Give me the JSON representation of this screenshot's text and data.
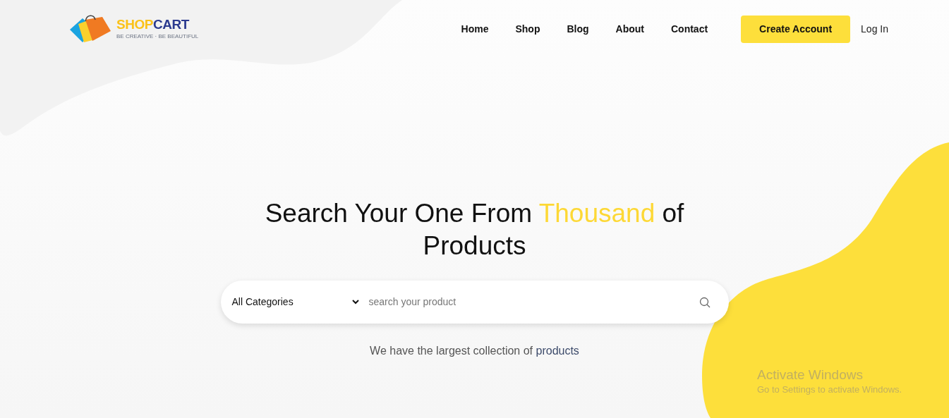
{
  "logo": {
    "brand_parts": [
      {
        "text": "SHOP",
        "highlight": true
      },
      {
        "text": "CART",
        "highlight": false
      }
    ],
    "tagline": "BE CREATIVE · BE BEAUTIFUL"
  },
  "nav": {
    "links": [
      "Home",
      "Shop",
      "Blog",
      "About",
      "Contact"
    ],
    "create_account": "Create Account",
    "login": "Log In"
  },
  "hero": {
    "headline_parts": [
      {
        "text": "Search Your One From ",
        "highlight": false
      },
      {
        "text": "Thousand",
        "highlight": true
      },
      {
        "text": " of Products",
        "highlight": false
      }
    ],
    "search": {
      "category": "All Categories",
      "placeholder": "search your product"
    },
    "subtitle_parts": [
      {
        "text": "We have the largest collection of ",
        "highlight": false
      },
      {
        "text": "products",
        "highlight": true
      }
    ]
  },
  "system_notice": {
    "title": "Activate Windows",
    "message": "Go to Settings to activate Windows."
  }
}
